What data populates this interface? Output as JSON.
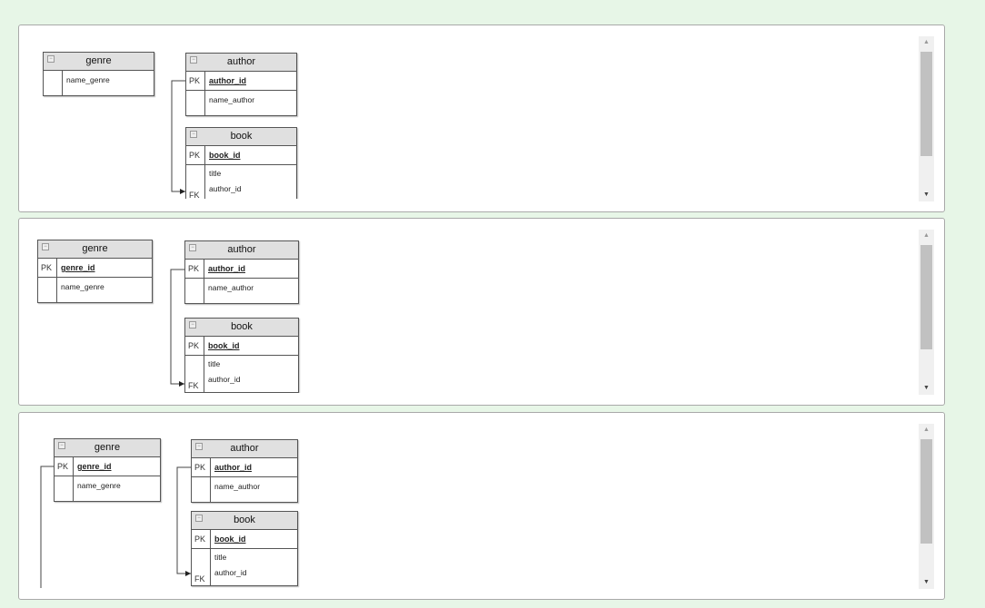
{
  "panels": [
    {
      "tables": [
        {
          "name": "genre",
          "rows": [
            {
              "key": "",
              "cols": [
                "name_genre"
              ]
            }
          ]
        },
        {
          "name": "author",
          "rows": [
            {
              "key": "PK",
              "cols": [
                "author_id"
              ],
              "pk": true
            },
            {
              "key": "",
              "cols": [
                "name_author"
              ]
            }
          ]
        },
        {
          "name": "book",
          "rows": [
            {
              "key": "PK",
              "cols": [
                "book_id"
              ],
              "pk": true
            },
            {
              "key": "FK",
              "cols": [
                "title",
                "author_id"
              ]
            }
          ]
        }
      ]
    },
    {
      "tables": [
        {
          "name": "genre",
          "rows": [
            {
              "key": "PK",
              "cols": [
                "genre_id"
              ],
              "pk": true
            },
            {
              "key": "",
              "cols": [
                "name_genre"
              ]
            }
          ]
        },
        {
          "name": "author",
          "rows": [
            {
              "key": "PK",
              "cols": [
                "author_id"
              ],
              "pk": true
            },
            {
              "key": "",
              "cols": [
                "name_author"
              ]
            }
          ]
        },
        {
          "name": "book",
          "rows": [
            {
              "key": "PK",
              "cols": [
                "book_id"
              ],
              "pk": true
            },
            {
              "key": "FK",
              "cols": [
                "title",
                "author_id"
              ]
            }
          ]
        }
      ]
    },
    {
      "tables": [
        {
          "name": "genre",
          "rows": [
            {
              "key": "PK",
              "cols": [
                "genre_id"
              ],
              "pk": true
            },
            {
              "key": "",
              "cols": [
                "name_genre"
              ]
            }
          ]
        },
        {
          "name": "author",
          "rows": [
            {
              "key": "PK",
              "cols": [
                "author_id"
              ],
              "pk": true
            },
            {
              "key": "",
              "cols": [
                "name_author"
              ]
            }
          ]
        },
        {
          "name": "book",
          "rows": [
            {
              "key": "PK",
              "cols": [
                "book_id"
              ],
              "pk": true
            },
            {
              "key": "FK",
              "cols": [
                "title",
                "author_id"
              ]
            }
          ]
        }
      ]
    }
  ],
  "scrollbar": {
    "up_icon": "▲",
    "down_icon": "▼"
  },
  "collapse_icon": "−"
}
